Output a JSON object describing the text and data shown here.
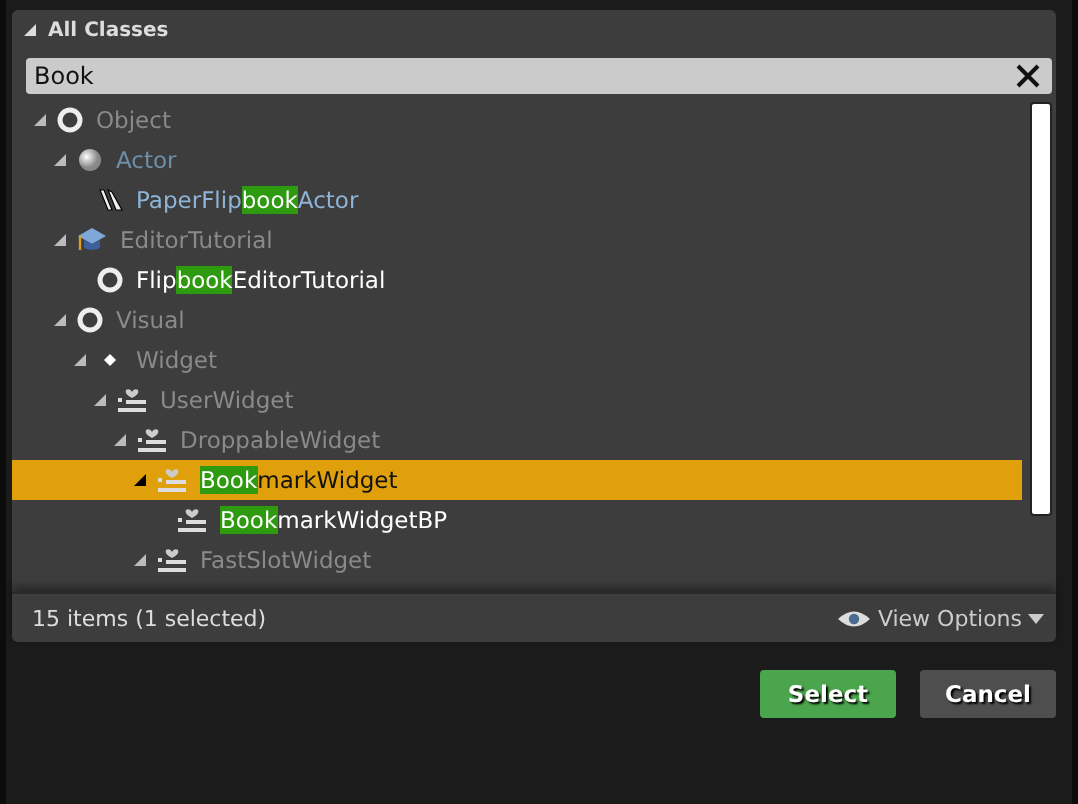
{
  "section": {
    "title": "All Classes",
    "expanded": true
  },
  "search": {
    "value": "Book"
  },
  "tree": [
    {
      "kind": "object",
      "before": "Object",
      "expanded": true,
      "selected": false,
      "children": [
        {
          "kind": "actor",
          "before": "Actor",
          "expanded": true,
          "selected": false,
          "children": [
            {
              "kind": "paper",
              "before": "PaperFlip",
              "match": "book",
              "after": "Actor",
              "selected": false
            }
          ]
        },
        {
          "kind": "tutorial",
          "before": "EditorTutorial",
          "expanded": true,
          "selected": false,
          "children": [
            {
              "kind": "object",
              "before": "Flip",
              "match": "book",
              "after": "EditorTutorial",
              "selected": false
            }
          ]
        },
        {
          "kind": "object",
          "before": "Visual",
          "expanded": true,
          "selected": false,
          "children": [
            {
              "kind": "dot",
              "before": "Widget",
              "expanded": true,
              "selected": false,
              "children": [
                {
                  "kind": "widget",
                  "before": "UserWidget",
                  "expanded": true,
                  "selected": false,
                  "children": [
                    {
                      "kind": "widget",
                      "before": "DroppableWidget",
                      "expanded": true,
                      "selected": false,
                      "children": [
                        {
                          "kind": "widget",
                          "match": "Book",
                          "after": "markWidget",
                          "expanded": true,
                          "selected": true,
                          "children": [
                            {
                              "kind": "widget",
                              "match": "Book",
                              "after": "markWidgetBP",
                              "selected": false
                            }
                          ]
                        },
                        {
                          "kind": "widget",
                          "before": "FastSlotWidget",
                          "expanded": true,
                          "selected": false
                        }
                      ]
                    }
                  ]
                }
              ]
            }
          ]
        }
      ]
    }
  ],
  "status": "15 items (1 selected)",
  "view_options": "View Options",
  "buttons": [
    {
      "kind": "primary",
      "label": "Select"
    },
    {
      "kind": "secondary",
      "label": "Cancel"
    }
  ]
}
